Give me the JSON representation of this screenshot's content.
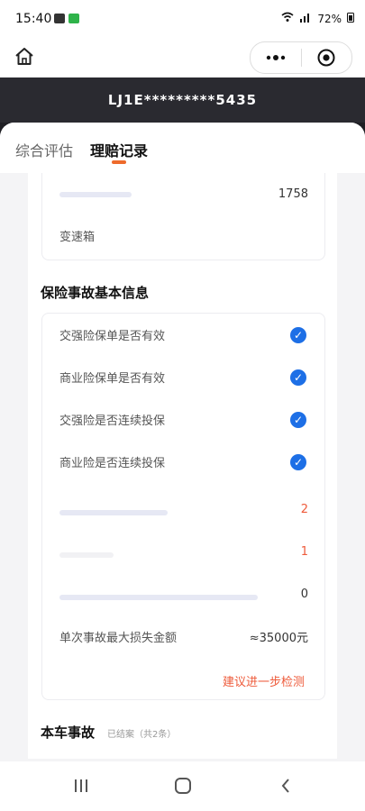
{
  "status_bar": {
    "time": "15:40",
    "battery": "72%"
  },
  "mini_program": {
    "more_icon": "more-dots-icon",
    "close_icon": "target-icon"
  },
  "vin": "LJ1E*********5435",
  "tabs": [
    {
      "label": "综合评估",
      "active": false
    },
    {
      "label": "理赔记录",
      "active": true
    }
  ],
  "vehicle_info": {
    "rows": [
      {
        "label": "",
        "value": "1758"
      },
      {
        "label": "变速箱",
        "value": ""
      }
    ]
  },
  "insurance": {
    "title": "保险事故基本信息",
    "checks": [
      {
        "label": "交强险保单是否有效"
      },
      {
        "label": "商业险保单是否有效"
      },
      {
        "label": "交强险是否连续投保"
      },
      {
        "label": "商业险是否连续投保"
      }
    ],
    "counts": [
      {
        "value": "2"
      },
      {
        "value": "1"
      },
      {
        "value": "0"
      }
    ],
    "max_loss_label": "单次事故最大损失金额",
    "max_loss_value": "≈35000元",
    "suggest": "建议进一步检测"
  },
  "accident": {
    "title": "本车事故",
    "subtitle": "已结案（共2条）"
  },
  "nav": {
    "recent": "|||",
    "home": "○",
    "back": "<"
  },
  "colors": {
    "accent": "#ee6a2b",
    "check_blue": "#1d6fe6",
    "warn_red": "#ee5a3a"
  }
}
